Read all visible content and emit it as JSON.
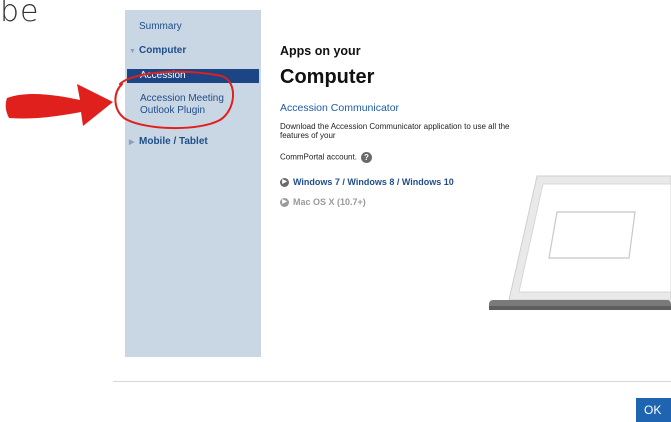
{
  "partial_text": "be",
  "sidebar": {
    "items": [
      {
        "label": "Summary"
      },
      {
        "label": "Computer"
      },
      {
        "label": "Accession"
      },
      {
        "label": "Accession Meeting Outlook Plugin"
      },
      {
        "label": "Mobile / Tablet"
      }
    ]
  },
  "content": {
    "subtitle": "Apps on your",
    "title": "Computer",
    "app_name": "Accession Communicator",
    "description": "Download the Accession Communicator application to use all the features of your",
    "description2": "CommPortal account.",
    "help_icon": "?",
    "downloads": [
      {
        "label": "Windows 7 / Windows 8 / Windows 10",
        "status": "active"
      },
      {
        "label": "Mac OS X (10.7+)",
        "status": "disabled"
      }
    ]
  },
  "footer": {
    "ok_label": "OK"
  },
  "colors": {
    "sidebar_bg": "#c9d6e4",
    "selected_bg": "#1c4585",
    "link": "#1f5aa8",
    "annotation": "#e0201c",
    "ok_button": "#1f64b0"
  }
}
